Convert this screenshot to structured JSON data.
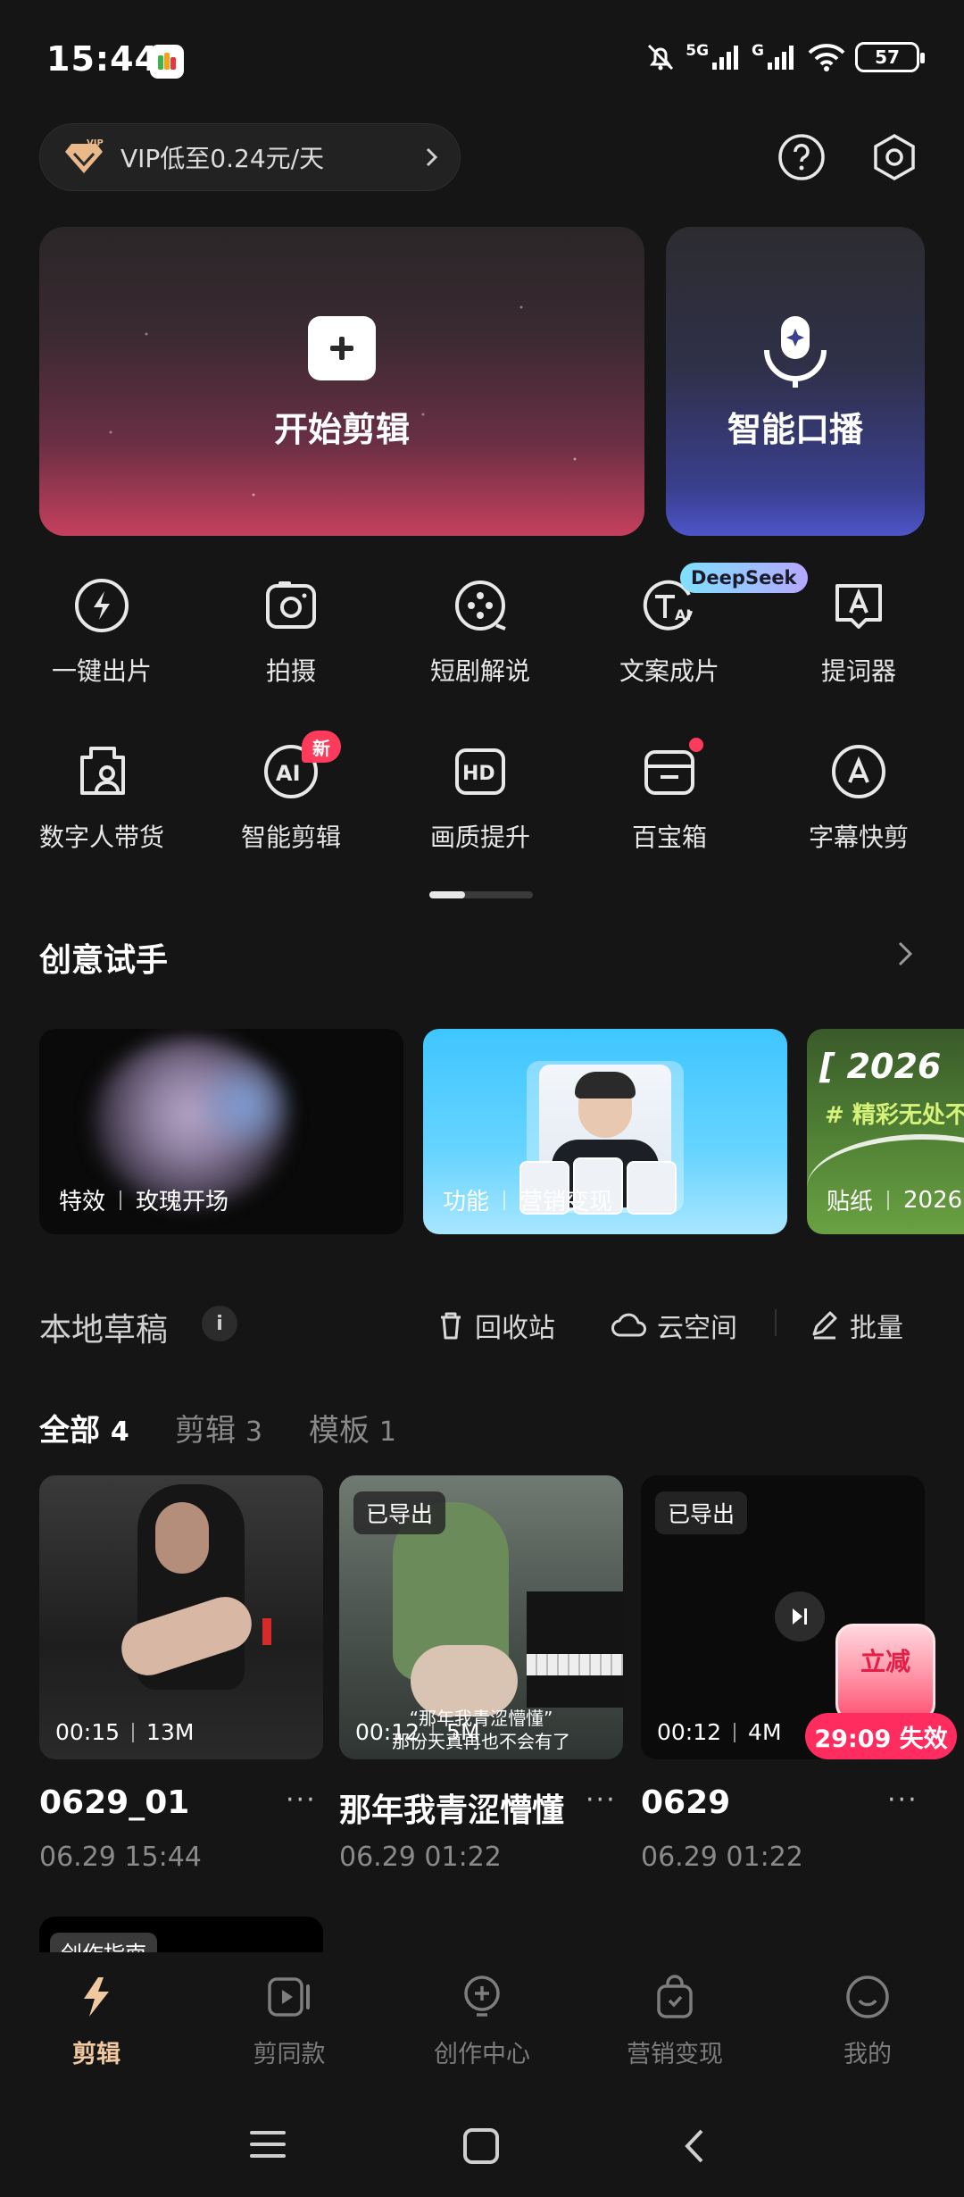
{
  "status_bar": {
    "time": "15:44",
    "battery": "57",
    "net_a": "5G",
    "net_b": "G"
  },
  "vip": {
    "label": "VIP低至0.24元/天"
  },
  "main_cards": {
    "edit_label": "开始剪辑",
    "voice_label": "智能口播"
  },
  "features": [
    {
      "label": "一键出片",
      "icon": "lightning-icon"
    },
    {
      "label": "拍摄",
      "icon": "camera-icon"
    },
    {
      "label": "短剧解说",
      "icon": "film-reel-icon"
    },
    {
      "label": "文案成片",
      "icon": "text-ai-icon",
      "badge": "DeepSeek"
    },
    {
      "label": "提词器",
      "icon": "teleprompter-icon"
    },
    {
      "label": "数字人带货",
      "icon": "digital-human-icon"
    },
    {
      "label": "智能剪辑",
      "icon": "ai-icon",
      "badge": "新"
    },
    {
      "label": "画质提升",
      "icon": "hd-icon"
    },
    {
      "label": "百宝箱",
      "icon": "toolbox-icon"
    },
    {
      "label": "字幕快剪",
      "icon": "subtitle-icon"
    }
  ],
  "creative": {
    "title": "创意试手",
    "cards": [
      {
        "type": "特效",
        "name": "玫瑰开场"
      },
      {
        "type": "功能",
        "name": "营销变现"
      },
      {
        "type": "贴纸",
        "name": "2026"
      }
    ],
    "third_banner": "[ 2026",
    "third_sub": "# 精彩无处不"
  },
  "drafts": {
    "title": "本地草稿",
    "recycle": "回收站",
    "cloud": "云空间",
    "batch": "批量",
    "tabs": [
      {
        "label": "全部",
        "count": "4"
      },
      {
        "label": "剪辑",
        "count": "3"
      },
      {
        "label": "模板",
        "count": "1"
      }
    ],
    "items": [
      {
        "title": "0629_01",
        "date": "06.29 15:44",
        "duration": "00:15",
        "size": "13M",
        "exported": ""
      },
      {
        "title": "那年我青涩懵懂",
        "date": "06.29 01:22",
        "duration": "00:12",
        "size": "5M",
        "exported": "已导出",
        "subtitle1": "“那年我青涩懵懂”",
        "subtitle2": "那份天真再也不会有了"
      },
      {
        "title": "0629",
        "date": "06.29 01:22",
        "duration": "00:12",
        "size": "4M",
        "exported": "已导出"
      }
    ],
    "promo": {
      "label": "立减",
      "countdown": "29:09 失效"
    },
    "guide": "创作指南"
  },
  "bottom_nav": [
    {
      "label": "剪辑",
      "icon": "scissors-bolt-icon",
      "active": true
    },
    {
      "label": "剪同款",
      "icon": "template-video-icon"
    },
    {
      "label": "创作中心",
      "icon": "bulb-icon"
    },
    {
      "label": "营销变现",
      "icon": "shopping-bag-icon"
    },
    {
      "label": "我的",
      "icon": "smile-icon"
    }
  ],
  "colors": {
    "background": "#151515",
    "accent_active": "#f1c9a0",
    "badge_red": "#ff3b5c"
  }
}
